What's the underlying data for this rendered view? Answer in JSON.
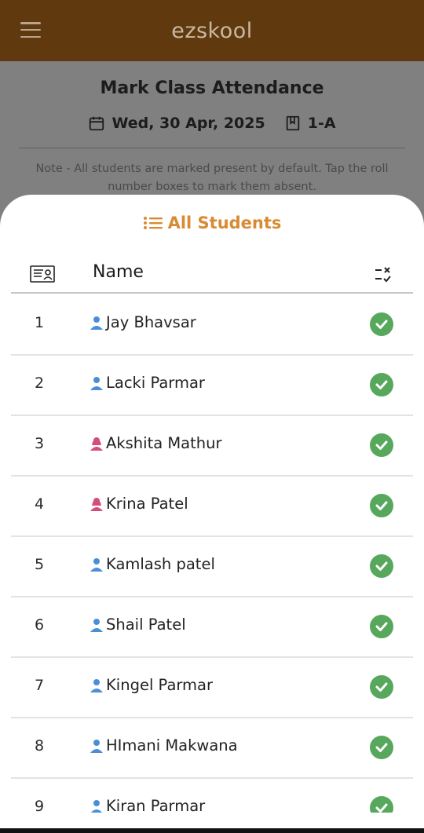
{
  "app": {
    "title": "ezskool"
  },
  "header": {
    "title": "Mark Class Attendance",
    "date": "Wed, 30 Apr, 2025",
    "class": "1-A",
    "note": "Note - All students are marked present by default. Tap the roll number boxes to mark them absent."
  },
  "sheet": {
    "title": "All Students",
    "column_name": "Name"
  },
  "colors": {
    "appbar": "#603a0e",
    "accent": "#d98a33",
    "present": "#57a75c",
    "male": "#4a8fd6",
    "female": "#d44f78"
  },
  "students": [
    {
      "roll": "1",
      "name": "Jay Bhavsar",
      "gender": "male",
      "status": "present"
    },
    {
      "roll": "2",
      "name": "Lacki Parmar",
      "gender": "male",
      "status": "present"
    },
    {
      "roll": "3",
      "name": "Akshita Mathur",
      "gender": "female",
      "status": "present"
    },
    {
      "roll": "4",
      "name": "Krina Patel",
      "gender": "female",
      "status": "present"
    },
    {
      "roll": "5",
      "name": "Kamlash patel",
      "gender": "male",
      "status": "present"
    },
    {
      "roll": "6",
      "name": "Shail Patel",
      "gender": "male",
      "status": "present"
    },
    {
      "roll": "7",
      "name": "Kingel Parmar",
      "gender": "male",
      "status": "present"
    },
    {
      "roll": "8",
      "name": "HImani Makwana",
      "gender": "male",
      "status": "present"
    },
    {
      "roll": "9",
      "name": "Kiran Parmar",
      "gender": "male",
      "status": "present"
    }
  ]
}
